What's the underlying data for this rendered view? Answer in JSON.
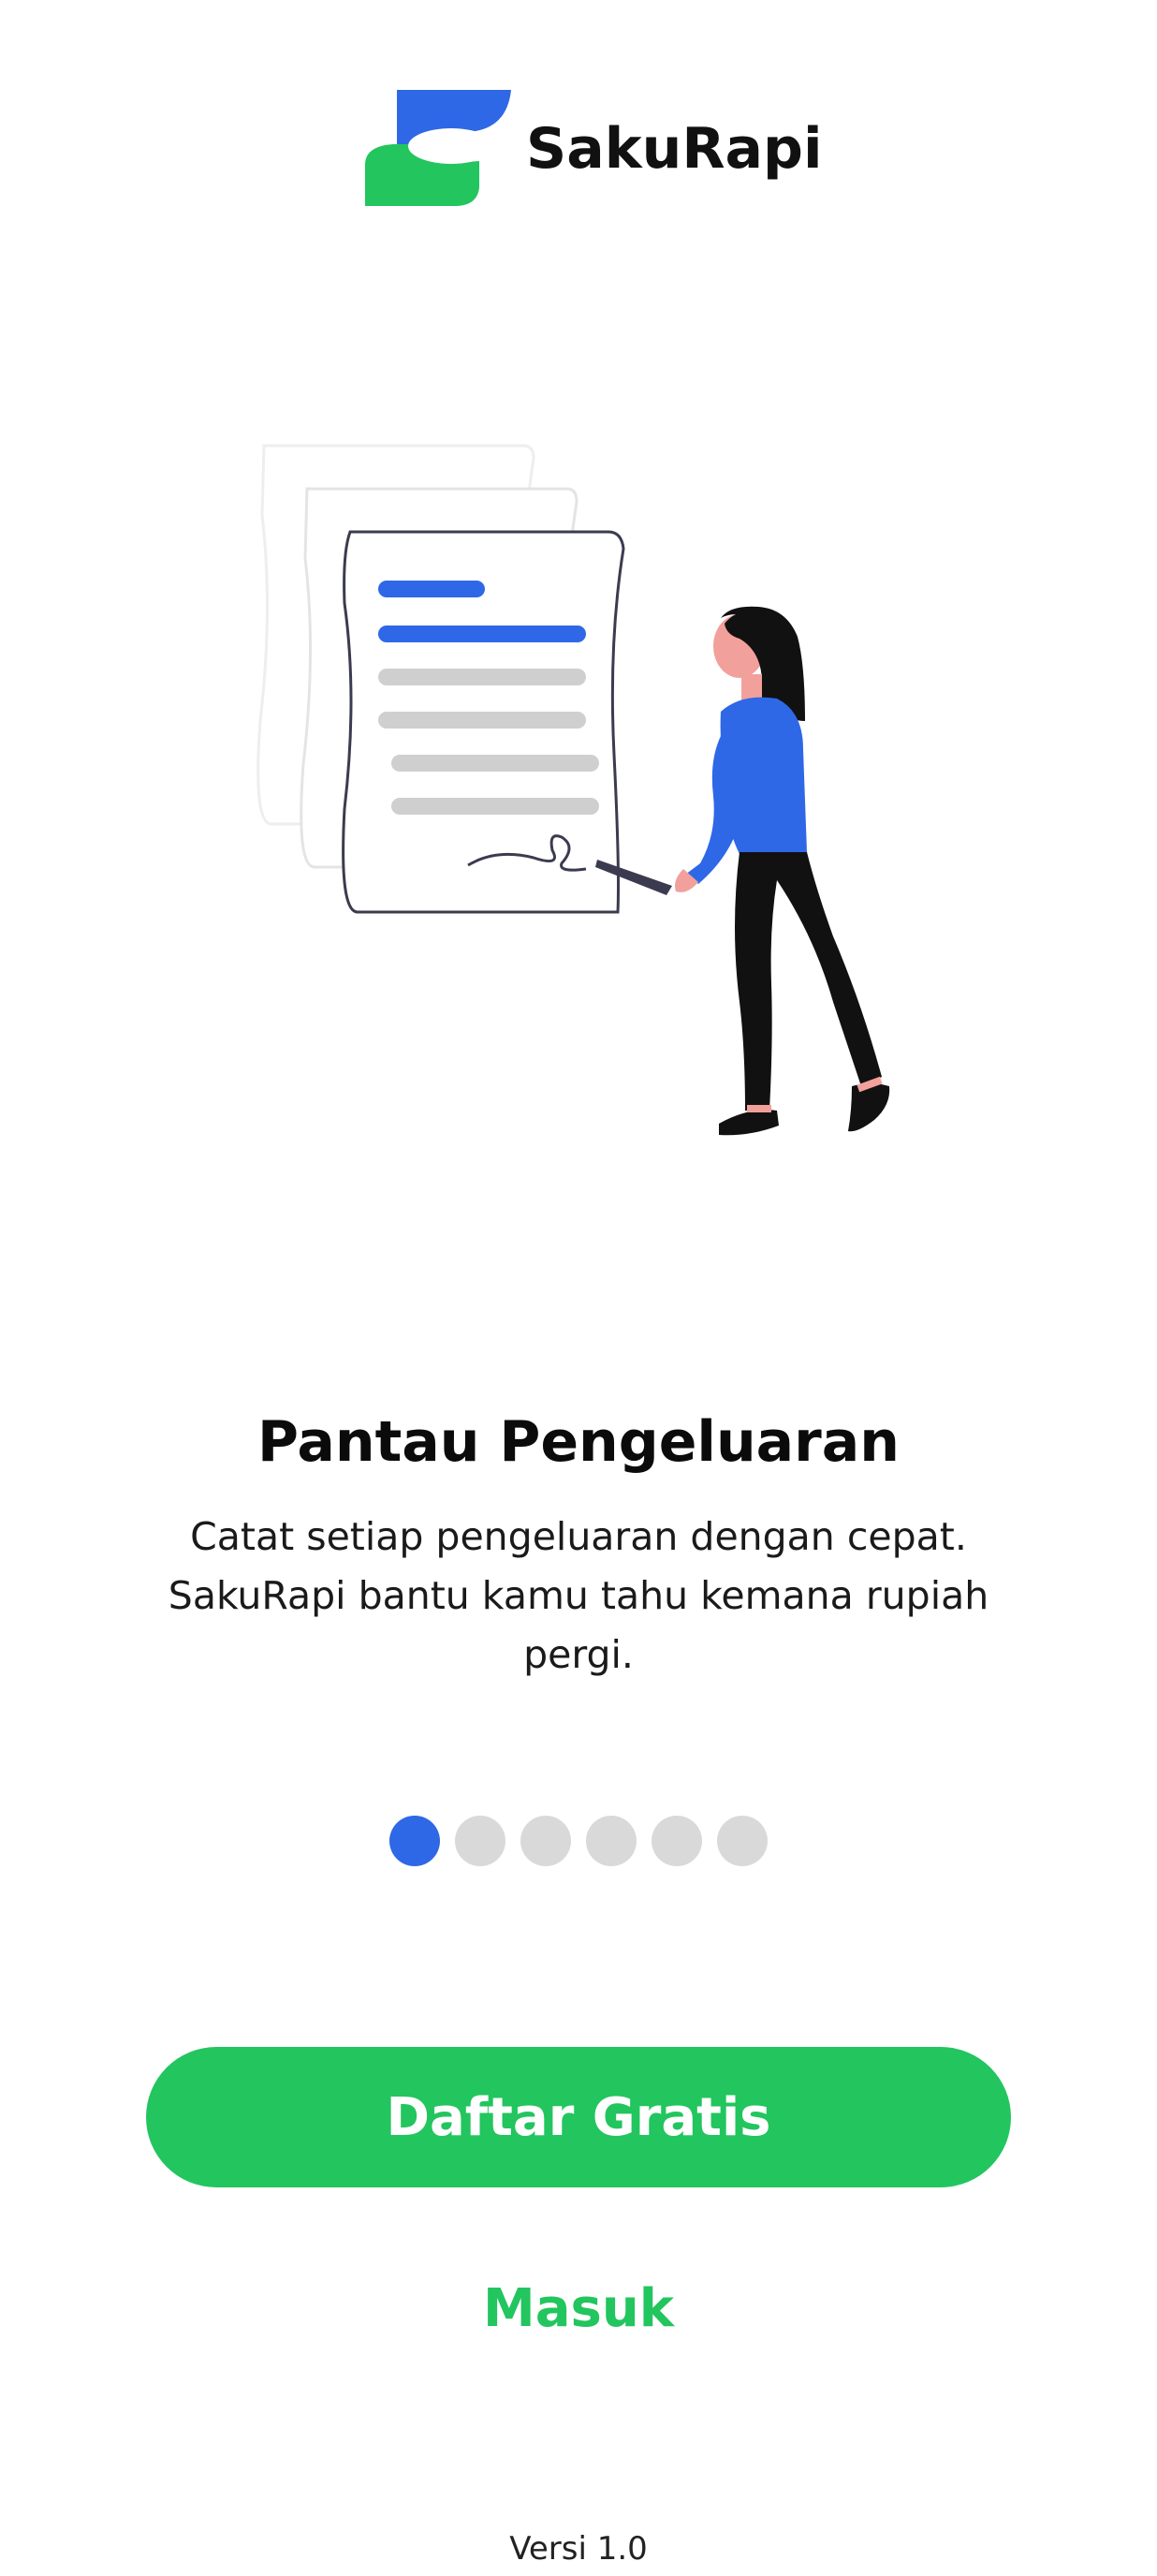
{
  "app": {
    "name": "SakuRapi",
    "logo_icon": "sakurapi-logo-icon"
  },
  "illustration": {
    "icon": "document-signing-illustration"
  },
  "slide": {
    "title": "Pantau Pengeluaran",
    "description": "Catat setiap pengeluaran dengan cepat. SakuRapi bantu kamu tahu kemana rupiah pergi."
  },
  "pagination": {
    "total": 6,
    "active_index": 0
  },
  "actions": {
    "primary_label": "Daftar Gratis",
    "secondary_label": "Masuk"
  },
  "footer": {
    "version": "Versi 1.0"
  },
  "colors": {
    "brand_blue": "#2e68e6",
    "brand_green": "#22c55e",
    "dot_inactive": "#d9d9d9"
  }
}
